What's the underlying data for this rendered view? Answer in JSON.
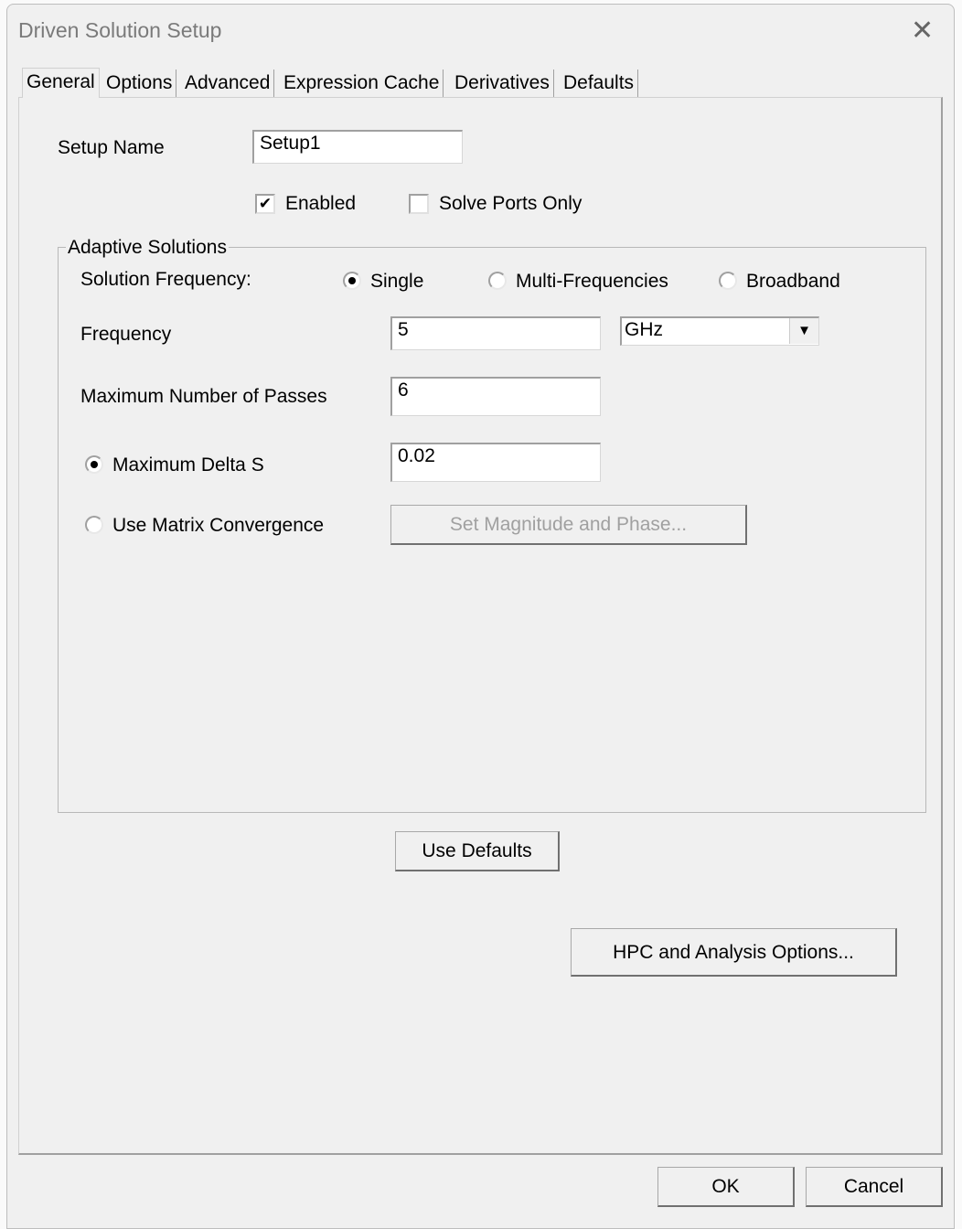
{
  "title": "Driven Solution Setup",
  "tabs": [
    "General",
    "Options",
    "Advanced",
    "Expression Cache",
    "Derivatives",
    "Defaults"
  ],
  "setup_name": {
    "label": "Setup Name",
    "value": "Setup1"
  },
  "enabled": {
    "label": "Enabled",
    "checked": true,
    "mark": "✔"
  },
  "solve_ports_only": {
    "label": "Solve Ports Only",
    "checked": false
  },
  "adaptive": {
    "legend": "Adaptive Solutions",
    "solution_frequency_label": "Solution Frequency:",
    "options": [
      "Single",
      "Multi-Frequencies",
      "Broadband"
    ],
    "selected": "Single",
    "frequency_label": "Frequency",
    "frequency_value": "5",
    "frequency_unit": "GHz",
    "max_passes_label": "Maximum Number of Passes",
    "max_passes_value": "6",
    "max_delta_s_label": "Maximum Delta S",
    "max_delta_s_value": "0.02",
    "matrix_convergence_label": "Use Matrix Convergence",
    "set_mag_phase_label": "Set Magnitude and Phase..."
  },
  "buttons": {
    "use_defaults": "Use Defaults",
    "hpc": "HPC and Analysis Options...",
    "ok": "OK",
    "cancel": "Cancel"
  }
}
